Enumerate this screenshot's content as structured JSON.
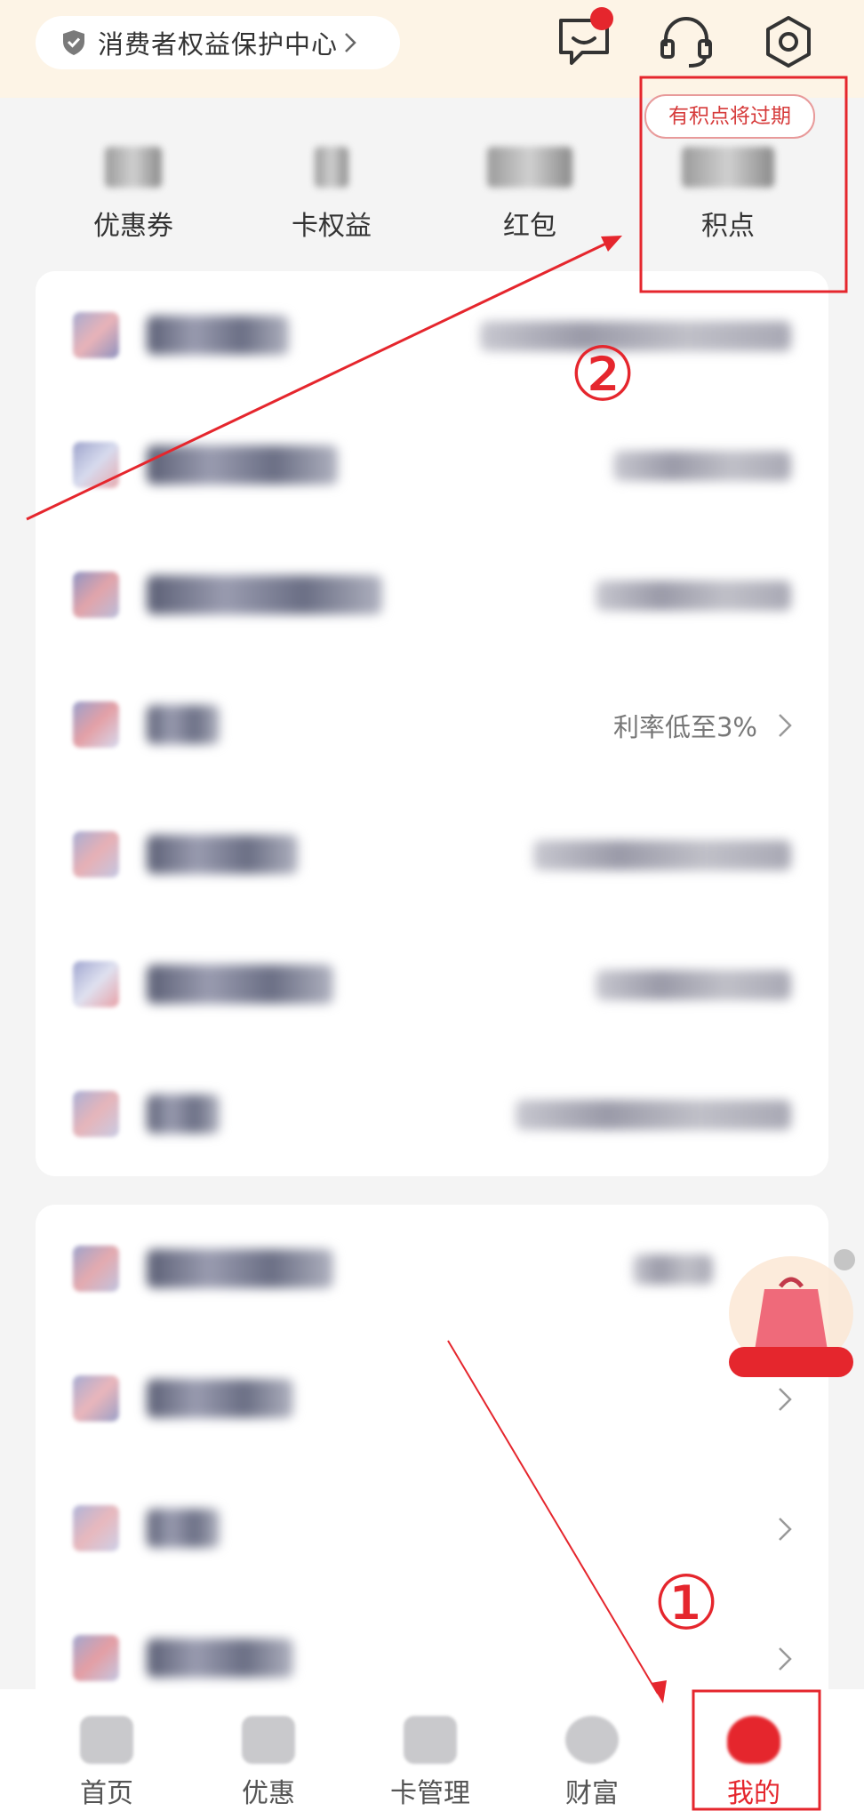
{
  "header": {
    "consumer_center": "消费者权益保护中心"
  },
  "icons": {
    "message": "chat-bubble-icon",
    "service": "headset-icon",
    "settings": "gear-icon",
    "shield": "shield-icon"
  },
  "stats": [
    {
      "label": "优惠券"
    },
    {
      "label": "卡权益"
    },
    {
      "label": "红包"
    },
    {
      "label": "积点"
    }
  ],
  "expire_badge": "有积点将过期",
  "rows_group1": [
    {
      "right_text": ""
    },
    {
      "right_text": ""
    },
    {
      "right_text": ""
    },
    {
      "right_text": "利率低至3%"
    },
    {
      "right_text": ""
    },
    {
      "right_text": ""
    },
    {
      "right_text": ""
    }
  ],
  "annotations": {
    "step1": "①",
    "step2": "②"
  },
  "nav": [
    {
      "label": "首页"
    },
    {
      "label": "优惠"
    },
    {
      "label": "卡管理"
    },
    {
      "label": "财富"
    },
    {
      "label": "我的"
    }
  ],
  "colors": {
    "accent": "#e5262d",
    "header_bg": "#fdf4e6"
  }
}
